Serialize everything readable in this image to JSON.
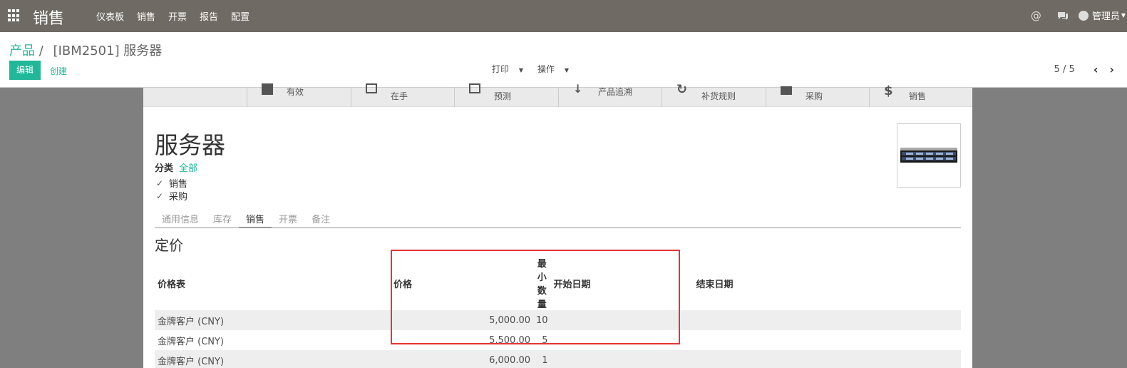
{
  "navbar": {
    "app_title": "销售",
    "menu": [
      "仪表板",
      "销售",
      "开票",
      "报告",
      "配置"
    ],
    "at_icon": "@",
    "user_name": "管理员"
  },
  "control_panel": {
    "breadcrumb_root": "产品",
    "breadcrumb_sep": "/",
    "breadcrumb_current": "[IBM2501] 服务器",
    "edit_label": "编辑",
    "create_label": "创建",
    "print_label": "打印",
    "action_label": "操作",
    "pager": "5 / 5"
  },
  "smart_buttons": [
    {
      "label": "有效",
      "icon": "archive-icon"
    },
    {
      "label": "在手",
      "icon": "building-icon"
    },
    {
      "label": "预测",
      "icon": "building-icon"
    },
    {
      "label": "产品追溯",
      "icon": "arrow-down-icon"
    },
    {
      "label": "补货规则",
      "icon": "refresh-icon"
    },
    {
      "label": "采购",
      "icon": "cart-icon"
    },
    {
      "label": "销售",
      "icon": "dollar-icon"
    }
  ],
  "product": {
    "name": "服务器",
    "category_label": "分类",
    "category_value": "全部",
    "sale_ok_label": "销售",
    "purchase_ok_label": "采购"
  },
  "tabs": [
    {
      "label": "通用信息",
      "active": false
    },
    {
      "label": "库存",
      "active": false
    },
    {
      "label": "销售",
      "active": true
    },
    {
      "label": "开票",
      "active": false
    },
    {
      "label": "备注",
      "active": false
    }
  ],
  "pricing": {
    "section_title": "定价",
    "columns": [
      "价格表",
      "价格",
      "最小数量",
      "开始日期",
      "结束日期"
    ],
    "rows": [
      {
        "pricelist": "金牌客户 (CNY)",
        "price": "5,000.00",
        "min_qty": "10",
        "date_start": "",
        "date_end": ""
      },
      {
        "pricelist": "金牌客户 (CNY)",
        "price": "5,500.00",
        "min_qty": "5",
        "date_start": "",
        "date_end": ""
      },
      {
        "pricelist": "金牌客户 (CNY)",
        "price": "6,000.00",
        "min_qty": "1",
        "date_start": "",
        "date_end": ""
      }
    ]
  },
  "colors": {
    "navbar": "#6f6a63",
    "accent": "#21b799",
    "highlight": "#e63535"
  }
}
